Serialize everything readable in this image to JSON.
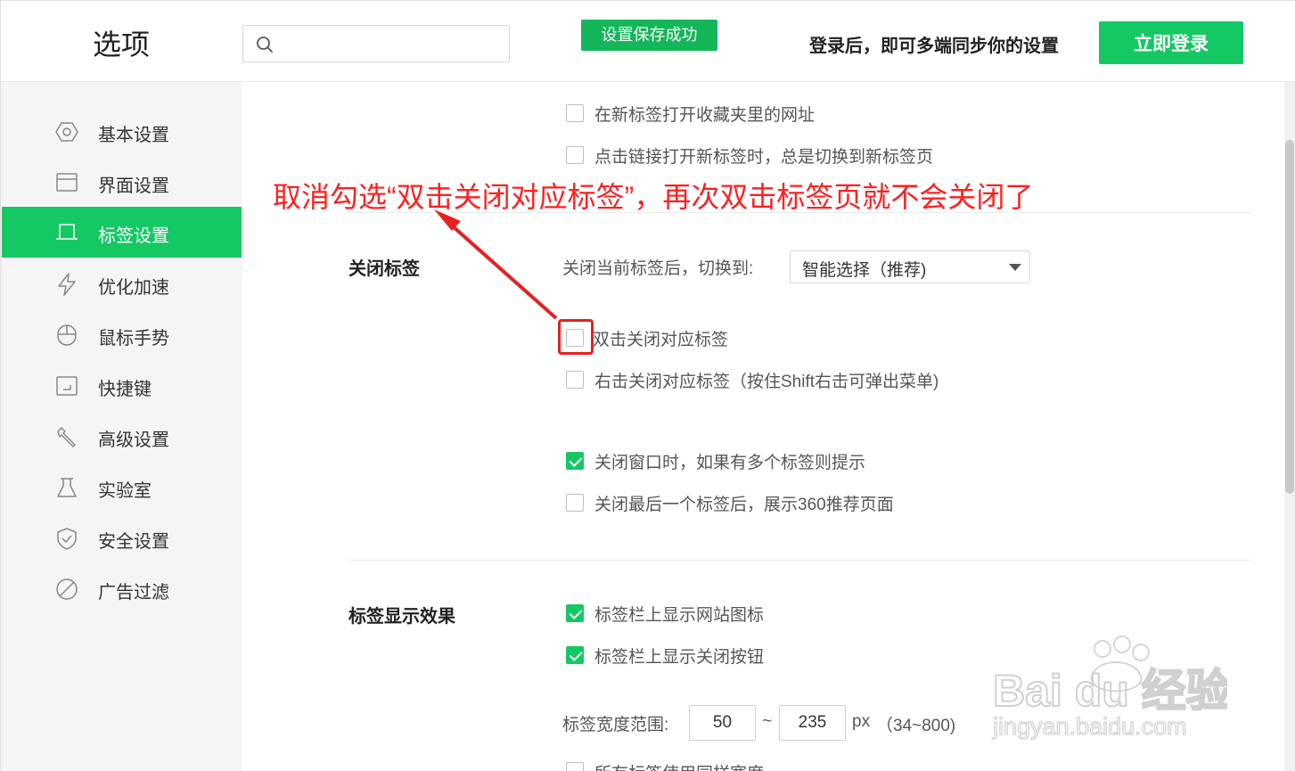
{
  "header": {
    "title": "选项",
    "search_placeholder": "",
    "toast": "设置保存成功",
    "sync_hint": "登录后，即可多端同步你的设置",
    "login_label": "立即登录"
  },
  "sidebar": {
    "items": [
      {
        "label": "基本设置",
        "icon": "hexagon-settings-icon"
      },
      {
        "label": "界面设置",
        "icon": "window-icon"
      },
      {
        "label": "标签设置",
        "icon": "tab-icon"
      },
      {
        "label": "优化加速",
        "icon": "lightning-icon"
      },
      {
        "label": "鼠标手势",
        "icon": "mouse-icon"
      },
      {
        "label": "快捷键",
        "icon": "keyboard-shortcut-icon"
      },
      {
        "label": "高级设置",
        "icon": "wrench-icon"
      },
      {
        "label": "实验室",
        "icon": "flask-icon"
      },
      {
        "label": "安全设置",
        "icon": "shield-icon"
      },
      {
        "label": "广告过滤",
        "icon": "block-icon"
      }
    ],
    "active_index": 2
  },
  "content": {
    "top_options": [
      {
        "label": "在新标签打开收藏夹里的网址",
        "checked": false
      },
      {
        "label": "点击链接打开新标签时，总是切换到新标签页",
        "checked": false
      }
    ],
    "close_tabs": {
      "title": "关闭标签",
      "switch_label": "关闭当前标签后，切换到:",
      "switch_value": "智能选择（推荐)",
      "options": [
        {
          "label": "双击关闭对应标签",
          "checked": false
        },
        {
          "label": "右击关闭对应标签（按住Shift右击可弹出菜单)",
          "checked": false
        },
        {
          "label": "关闭窗口时，如果有多个标签则提示",
          "checked": true
        },
        {
          "label": "关闭最后一个标签后，展示360推荐页面",
          "checked": false
        }
      ]
    },
    "tab_display": {
      "title": "标签显示效果",
      "options": [
        {
          "label": "标签栏上显示网站图标",
          "checked": true
        },
        {
          "label": "标签栏上显示关闭按钮",
          "checked": true
        }
      ],
      "width_label": "标签宽度范围:",
      "width_min": "50",
      "width_separator": "~",
      "width_max": "235",
      "width_unit": "px",
      "width_range_hint": "（34~800)",
      "partial_option": "所有标签使用同样宽度"
    }
  },
  "annotation": {
    "text": "取消勾选“双击关闭对应标签”，再次双击标签页就不会关闭了",
    "color": "#ff1f1f"
  },
  "watermark": {
    "brand": "Bai du 经验",
    "url": "jingyan.baidu.com"
  },
  "colors": {
    "accent": "#14c864",
    "toast": "#14b65a",
    "annotation": "#ff1f1f"
  }
}
